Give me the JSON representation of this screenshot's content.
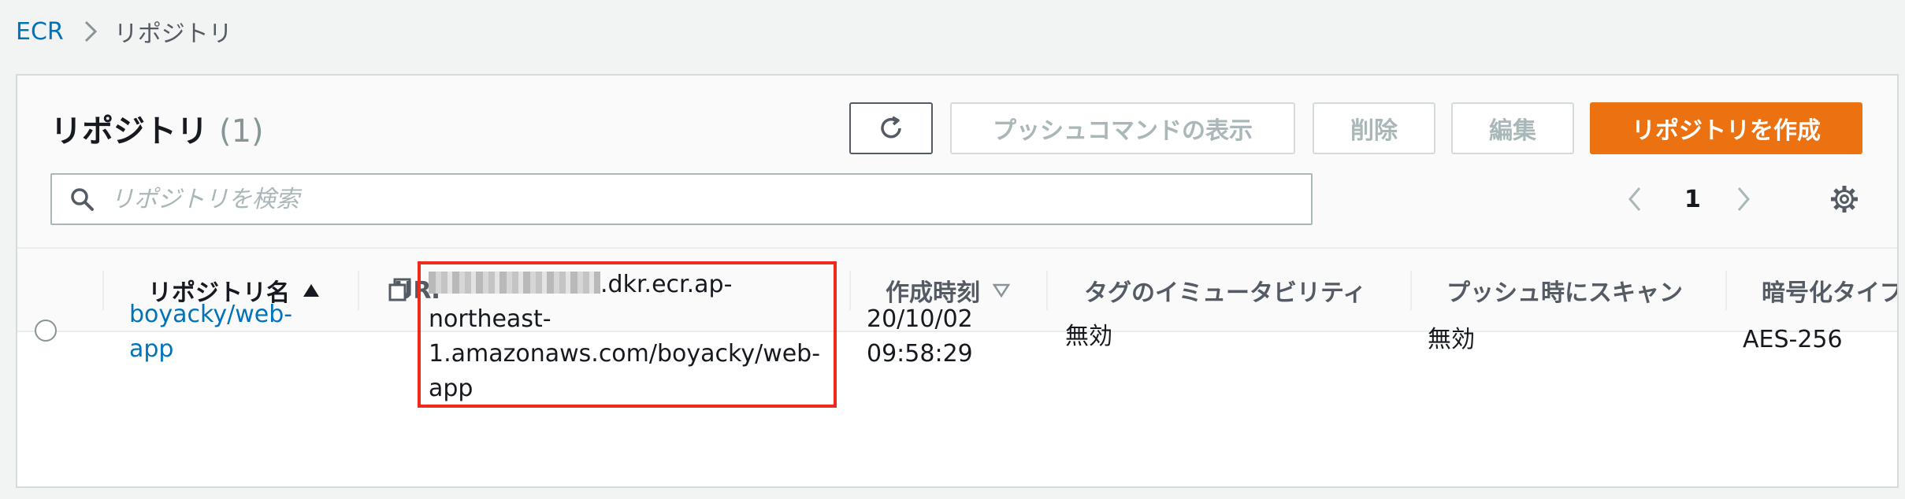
{
  "breadcrumb": {
    "root": "ECR",
    "current": "リポジトリ"
  },
  "panel": {
    "title": "リポジトリ",
    "count": "(1)",
    "buttons": {
      "push_commands": "プッシュコマンドの表示",
      "delete": "削除",
      "edit": "編集",
      "create": "リポジトリを作成"
    },
    "search": {
      "placeholder": "リポジトリを検索",
      "value": ""
    },
    "pagination": {
      "current_page": "1"
    }
  },
  "table": {
    "columns": {
      "name": "リポジトリ名",
      "uri": "URI",
      "created": "作成時刻",
      "tag_mutability": "タグのイミュータビリティ",
      "scan_on_push": "プッシュ時にスキャン",
      "encryption": "暗号化タイプ"
    },
    "rows": [
      {
        "name": "boyacky/web-app",
        "uri_suffix": ".dkr.ecr.ap-northeast-1.amazonaws.com/boyacky/web-app",
        "created_date": "20/10/02",
        "created_time": "09:58:29",
        "tag_mutability": "無効",
        "scan_on_push": "無効",
        "encryption": "AES-256"
      }
    ]
  },
  "colors": {
    "link": "#0073bb",
    "primary_button": "#ec7211",
    "highlight_box": "#ef2a1c",
    "disabled_text": "#aab7b8"
  },
  "icons": [
    "chevron-right-icon",
    "refresh-icon",
    "search-icon",
    "chevron-left-icon",
    "gear-icon",
    "sort-ascending-icon",
    "sort-descending-icon",
    "copy-icon"
  ]
}
